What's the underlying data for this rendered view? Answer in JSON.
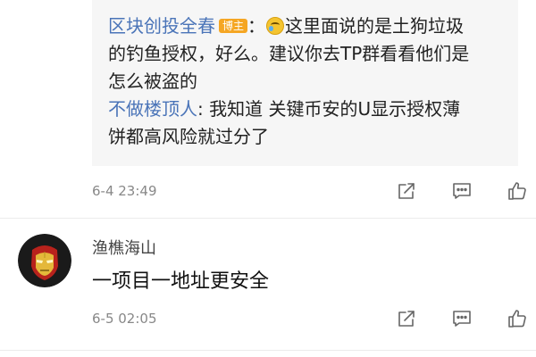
{
  "reply_box": {
    "reply1": {
      "author": "区块创投全春",
      "badge": "博主",
      "sep": "：",
      "emoji_icon": "crying-laughing-emoji",
      "text_line1": "这里面说的是土狗垃圾",
      "text_line2": "的钓鱼授权，好么。建议你去TP群看看他们是",
      "text_line3": "怎么被盗的"
    },
    "reply2": {
      "author": "不做楼顶人",
      "sep": ":",
      "text_line1": " 我知道 关键币安的U显示授权薄",
      "text_line2": "饼都高风险就过分了"
    }
  },
  "comment1": {
    "timestamp": "6-4 23:49",
    "actions": [
      "share-icon",
      "comment-icon",
      "like-icon"
    ]
  },
  "comment2": {
    "avatar": "iron-man-avatar",
    "author": "渔樵海山",
    "text": "一项目一地址更安全",
    "timestamp": "6-5 02:05",
    "actions": [
      "share-icon",
      "comment-icon",
      "like-icon"
    ]
  },
  "colors": {
    "link": "#4a74b8",
    "badge": "#f5a623",
    "reply_bg": "#f6f6f6",
    "timestamp": "#888888"
  }
}
